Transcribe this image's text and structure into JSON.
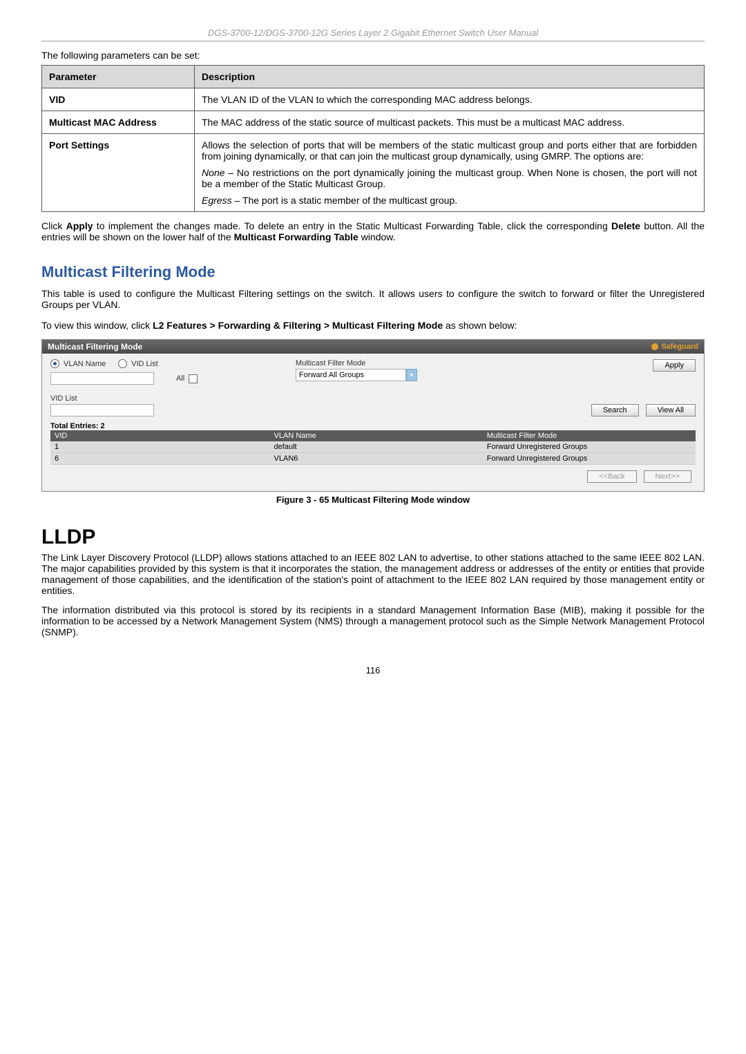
{
  "doc_header": "DGS-3700-12/DGS-3700-12G Series Layer 2 Gigabit Ethernet Switch User Manual",
  "intro": "The following parameters can be set:",
  "table": {
    "header": {
      "param": "Parameter",
      "desc": "Description"
    },
    "rows": [
      {
        "name": "VID",
        "paras": [
          "The VLAN ID of the VLAN to which the corresponding MAC address belongs."
        ]
      },
      {
        "name": "Multicast MAC Address",
        "paras": [
          "The MAC address of the static source of multicast packets. This must be a multicast MAC address."
        ]
      },
      {
        "name": "Port Settings",
        "paras": [
          "Allows the selection of ports that will be members of the static multicast group and ports either that are forbidden from joining dynamically, or that can join the multicast group dynamically, using GMRP. The options are:",
          "None – No restrictions on the port dynamically joining the multicast group. When None is chosen, the port will not be a member of the Static Multicast Group.",
          "Egress – The port is a static member of the multicast group."
        ],
        "italics": [
          "None",
          "Egress"
        ]
      }
    ]
  },
  "apply_note_parts": {
    "p1": "Click ",
    "b1": "Apply",
    "p2": " to implement the changes made. To delete an entry in the Static Multicast Forwarding Table, click the corresponding ",
    "b2": "Delete",
    "p3": " button. All the entries will be shown on the lower half of the ",
    "b3": "Multicast Forwarding Table",
    "p4": " window."
  },
  "section1": {
    "title": "Multicast Filtering Mode",
    "intro": "This table is used to configure the Multicast Filtering settings on the switch. It allows users to configure the switch to forward or filter the Unregistered Groups per VLAN.",
    "nav_prefix": "To view this window, click ",
    "nav_bold": "L2 Features > Forwarding & Filtering > Multicast Filtering Mode",
    "nav_suffix": " as shown below:"
  },
  "screenshot": {
    "title": "Multicast Filtering Mode",
    "safeguard": "Safeguard",
    "radio1": "VLAN Name",
    "radio2": "VID List",
    "all_label": "All",
    "filter_label": "Multicast Filter Mode",
    "dropdown_value": "Forward All Groups",
    "apply": "Apply",
    "vid_list_label": "VID List",
    "search": "Search",
    "view_all": "View All",
    "total_entries": "Total Entries: 2",
    "thead": {
      "c1": "VID",
      "c2": "VLAN Name",
      "c3": "Multicast Filter Mode"
    },
    "rows": [
      {
        "c1": "1",
        "c2": "default",
        "c3": "Forward Unregistered Groups"
      },
      {
        "c1": "6",
        "c2": "VLAN6",
        "c3": "Forward Unregistered Groups"
      }
    ],
    "back": "<<Back",
    "next": "Next>>"
  },
  "figure_caption": "Figure 3 - 65 Multicast Filtering Mode window",
  "section2": {
    "title": "LLDP",
    "p1": "The Link Layer Discovery Protocol (LLDP) allows stations attached to an IEEE 802 LAN to advertise, to other stations attached to the same IEEE 802 LAN. The major capabilities provided by this system is that it incorporates the station, the management address or addresses of the entity or entities that provide management of those capabilities, and the identification of the station's point of attachment to the IEEE 802 LAN required by those management entity or entities.",
    "p2": "The information distributed via this protocol is stored by its recipients in a standard Management Information Base (MIB), making it possible for the information to be accessed by a Network Management System (NMS) through a management protocol such as the Simple Network Management Protocol (SNMP)."
  },
  "page_number": "116"
}
